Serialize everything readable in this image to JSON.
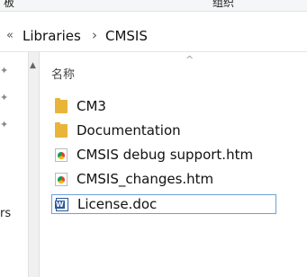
{
  "ribbon": {
    "left_fragment": "板",
    "right_fragment": "组织"
  },
  "breadcrumb": {
    "chevron": "«",
    "items": [
      "Libraries",
      "CMSIS"
    ],
    "separator": "›"
  },
  "navigation": {
    "partial_label": "rs"
  },
  "list": {
    "column_header": "名称",
    "sort_glyph": "^",
    "files": [
      {
        "name": "CM3",
        "icon": "folder-icon"
      },
      {
        "name": "Documentation",
        "icon": "folder-icon"
      },
      {
        "name": "CMSIS debug support.htm",
        "icon": "chrome-html-icon"
      },
      {
        "name": "CMSIS_changes.htm",
        "icon": "chrome-html-icon"
      },
      {
        "name": "License.doc",
        "icon": "word-document-icon",
        "selected": true
      }
    ]
  },
  "colors": {
    "folder": "#e8b53a",
    "selection_border": "#6f9fd8",
    "word": "#2b579a"
  }
}
